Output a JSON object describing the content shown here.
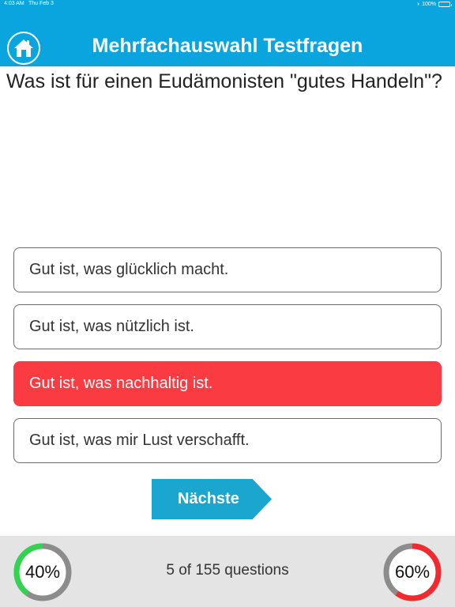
{
  "status_bar": {
    "time": "4:03 AM",
    "date": "Thu Feb 3",
    "battery": "100%"
  },
  "header": {
    "title": "Mehrfachauswahl Testfragen",
    "home_icon": "home-icon",
    "color": "#0aa5de"
  },
  "question": {
    "text": "Was ist für einen Eudämonisten \"gutes Handeln\"?"
  },
  "answers": [
    {
      "label": "Gut ist, was glücklich macht.",
      "state": "default"
    },
    {
      "label": "Gut ist, was nützlich ist.",
      "state": "default"
    },
    {
      "label": "Gut ist, was nachhaltig ist.",
      "state": "wrong"
    },
    {
      "label": "Gut ist, was mir Lust verschafft.",
      "state": "default"
    }
  ],
  "next_button": {
    "label": "Nächste"
  },
  "footer": {
    "progress_text": "5 of 155 questions",
    "correct": {
      "label": "40%",
      "value": 0.4,
      "color": "#34d34f"
    },
    "wrong": {
      "label": "60%",
      "value": 0.6,
      "color": "#f02a2f"
    },
    "track_color": "#8c8c8c"
  },
  "colors": {
    "wrong_answer": "#fa3c42",
    "next_button": "#1ba6cf"
  }
}
